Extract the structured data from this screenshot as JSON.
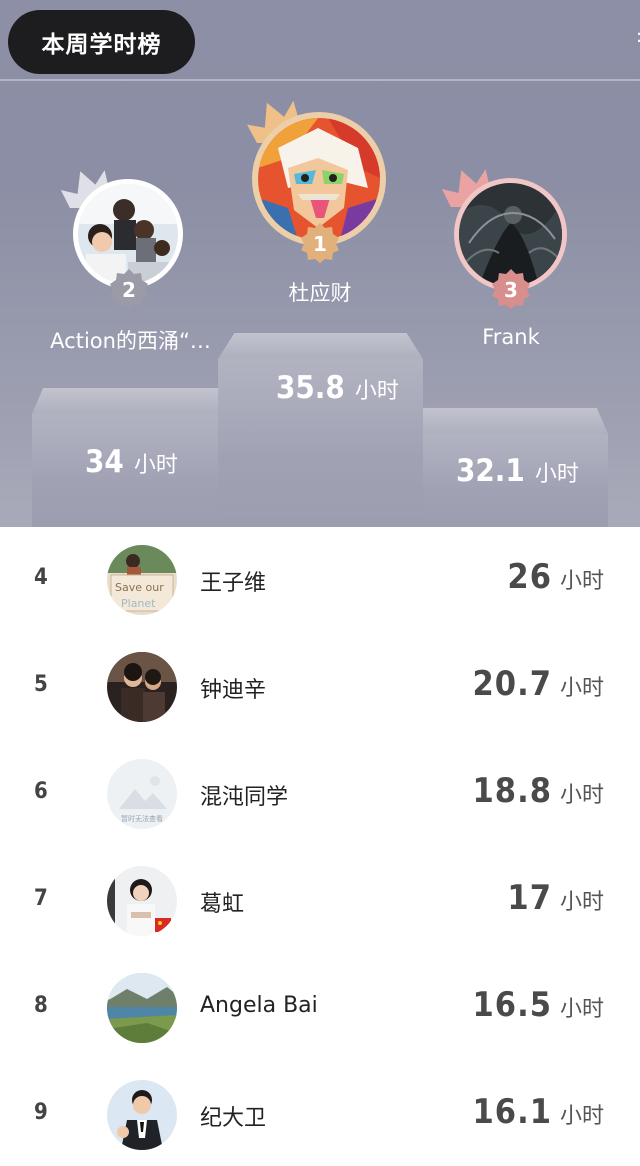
{
  "header": {
    "title": "本周学时榜"
  },
  "podium": [
    {
      "rank": "2",
      "name": "Action的西涌“…",
      "hours": "34",
      "unit": "小时",
      "medal_color": "#9a9ba6",
      "crown_color": "#e6e6ec"
    },
    {
      "rank": "1",
      "name": "杜应财",
      "hours": "35.8",
      "unit": "小时",
      "medal_color": "#e2b07a",
      "crown_color": "#f0c089"
    },
    {
      "rank": "3",
      "name": "Frank",
      "hours": "32.1",
      "unit": "小时",
      "medal_color": "#d98e8e",
      "crown_color": "#e9a3a3"
    }
  ],
  "list": [
    {
      "rank": "4",
      "name": "王子维",
      "hours": "26",
      "unit": "小时"
    },
    {
      "rank": "5",
      "name": "钟迪辛",
      "hours": "20.7",
      "unit": "小时"
    },
    {
      "rank": "6",
      "name": "混沌同学",
      "hours": "18.8",
      "unit": "小时"
    },
    {
      "rank": "7",
      "name": "葛虹",
      "hours": "17",
      "unit": "小时"
    },
    {
      "rank": "8",
      "name": "Angela Bai",
      "hours": "16.5",
      "unit": "小时"
    },
    {
      "rank": "9",
      "name": "纪大卫",
      "hours": "16.1",
      "unit": "小时"
    }
  ],
  "avatar_texts": {
    "sign_line1": "Save our",
    "sign_line2": "Planet",
    "placeholder_caption": "暂时无法查看"
  }
}
